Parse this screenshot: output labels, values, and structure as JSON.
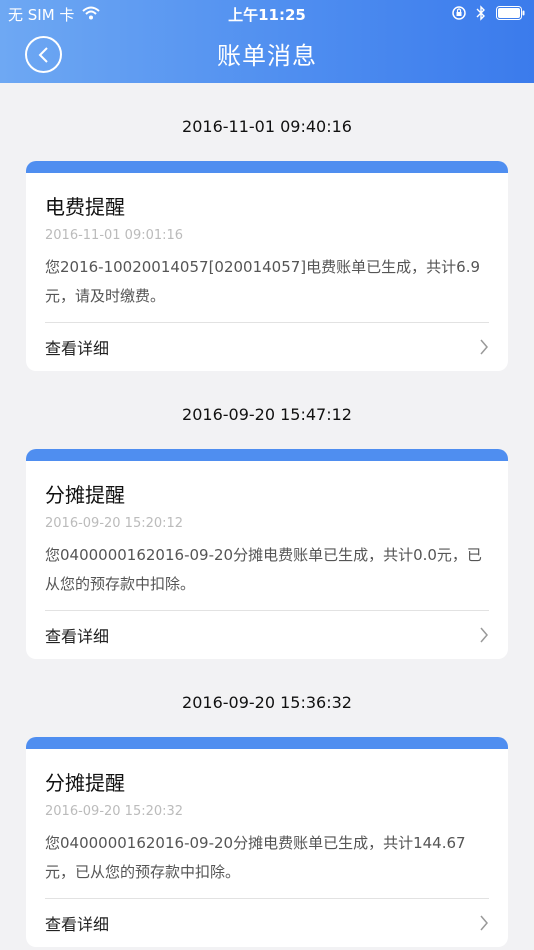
{
  "status_bar": {
    "carrier": "无 SIM 卡",
    "time": "上午11:25"
  },
  "nav": {
    "title": "账单消息"
  },
  "messages": [
    {
      "date": "2016-11-01 09:40:16",
      "title": "电费提醒",
      "time": "2016-11-01 09:01:16",
      "text": "您2016-10020014057[020014057]电费账单已生成，共计6.9元，请及时缴费。",
      "link": "查看详细"
    },
    {
      "date": "2016-09-20 15:47:12",
      "title": "分摊提醒",
      "time": "2016-09-20 15:20:12",
      "text": "您0400000162016-09-20分摊电费账单已生成，共计0.0元，已从您的预存款中扣除。",
      "link": "查看详细"
    },
    {
      "date": "2016-09-20 15:36:32",
      "title": "分摊提醒",
      "time": "2016-09-20 15:20:32",
      "text": "您0400000162016-09-20分摊电费账单已生成，共计144.67元，已从您的预存款中扣除。",
      "link": "查看详细"
    }
  ]
}
